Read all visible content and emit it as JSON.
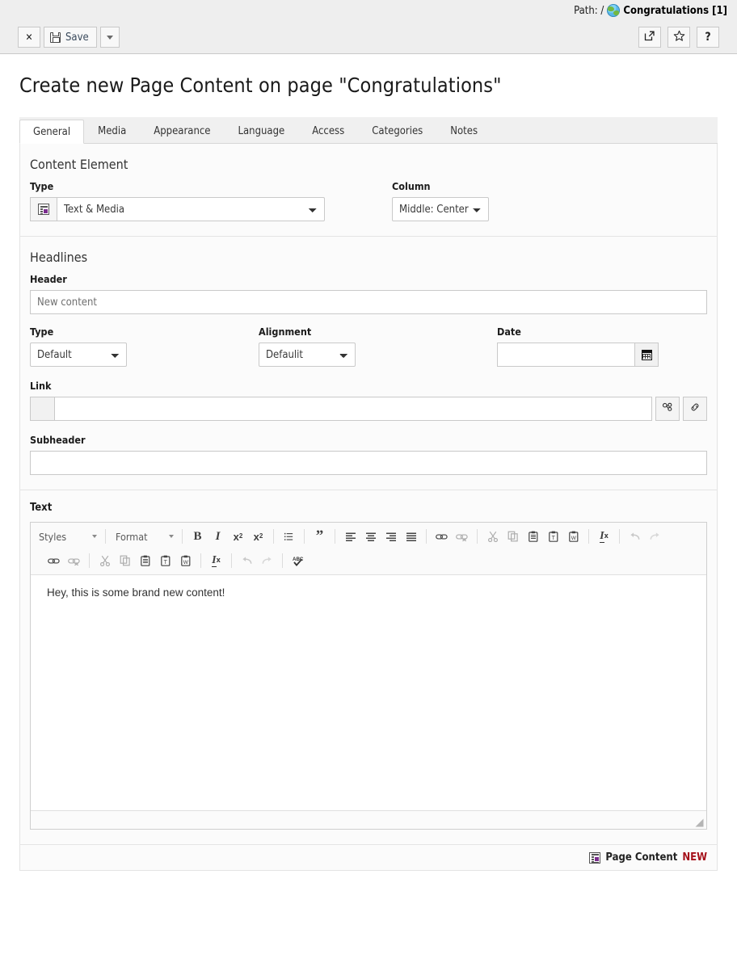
{
  "topbar": {
    "path_label": "Path: /",
    "globe_icon": "globe-icon",
    "page_name": "Congratulations [1]",
    "close_label": "✕",
    "save_label": "Save",
    "save_icon": "floppy-disk-icon",
    "save_caret": "caret-down-icon",
    "open_in_new_label": "open-in-new-icon",
    "bookmark_label": "star-icon",
    "help_label": "?"
  },
  "page_title": "Create new Page Content on page \"Congratulations\"",
  "tabs": [
    {
      "label": "General",
      "active": true
    },
    {
      "label": "Media",
      "active": false
    },
    {
      "label": "Appearance",
      "active": false
    },
    {
      "label": "Language",
      "active": false
    },
    {
      "label": "Access",
      "active": false
    },
    {
      "label": "Categories",
      "active": false
    },
    {
      "label": "Notes",
      "active": false
    }
  ],
  "content_element": {
    "section_title": "Content Element",
    "type_label": "Type",
    "type_value": "Text & Media",
    "type_icon": "text-media-icon",
    "column_label": "Column",
    "column_value": "Middle: Center"
  },
  "headlines": {
    "section_title": "Headlines",
    "header_label": "Header",
    "header_value": "New content",
    "header_placeholder": "New content",
    "type_label": "Type",
    "type_value": "Default",
    "alignment_label": "Alignment",
    "alignment_value": "Defaulit",
    "date_label": "Date",
    "date_value": "",
    "date_icon": "calendar-icon",
    "link_label": "Link",
    "link_value": "",
    "link_browse_icon": "link-browse-icon",
    "link_wizard_icon": "link-chain-icon",
    "subheader_label": "Subheader",
    "subheader_value": ""
  },
  "rte": {
    "label": "Text",
    "styles_label": "Styles",
    "format_label": "Format",
    "row1": [
      {
        "name": "bold-icon",
        "glyph": "B",
        "dim": false
      },
      {
        "name": "italic-icon",
        "glyph": "I",
        "dim": false
      },
      {
        "name": "subscript-icon",
        "glyph": "x₂",
        "dim": false
      },
      {
        "name": "superscript-icon",
        "glyph": "x²",
        "dim": false
      },
      {
        "name": "bulleted-list-icon",
        "glyph": "≡",
        "dim": false
      },
      {
        "name": "blockquote-icon",
        "glyph": "”",
        "dim": false
      },
      {
        "name": "align-left-icon",
        "glyph": "",
        "dim": false
      },
      {
        "name": "align-center-icon",
        "glyph": "",
        "dim": false
      },
      {
        "name": "align-right-icon",
        "glyph": "",
        "dim": false
      },
      {
        "name": "align-justify-icon",
        "glyph": "",
        "dim": false
      },
      {
        "name": "link-icon",
        "glyph": "",
        "dim": false
      },
      {
        "name": "unlink-icon",
        "glyph": "",
        "dim": true
      },
      {
        "name": "cut-icon",
        "glyph": "",
        "dim": true
      },
      {
        "name": "copy-icon",
        "glyph": "",
        "dim": true
      },
      {
        "name": "paste-icon",
        "glyph": "",
        "dim": false
      },
      {
        "name": "paste-as-text-icon",
        "glyph": "",
        "dim": false
      },
      {
        "name": "paste-from-word-icon",
        "glyph": "",
        "dim": false
      },
      {
        "name": "remove-format-icon",
        "glyph": "",
        "dim": false
      },
      {
        "name": "undo-icon",
        "glyph": "",
        "dim": true
      },
      {
        "name": "redo-icon",
        "glyph": "",
        "dim": true
      }
    ],
    "row2": [
      {
        "name": "link-icon",
        "glyph": "",
        "dim": false
      },
      {
        "name": "unlink-icon",
        "glyph": "",
        "dim": true
      },
      {
        "name": "cut-icon",
        "glyph": "",
        "dim": true
      },
      {
        "name": "copy-icon",
        "glyph": "",
        "dim": true
      },
      {
        "name": "paste-icon",
        "glyph": "",
        "dim": false
      },
      {
        "name": "paste-as-text-icon",
        "glyph": "",
        "dim": false
      },
      {
        "name": "paste-from-word-icon",
        "glyph": "",
        "dim": false
      },
      {
        "name": "remove-format-icon",
        "glyph": "",
        "dim": false
      },
      {
        "name": "undo-icon",
        "glyph": "",
        "dim": true
      },
      {
        "name": "redo-icon",
        "glyph": "",
        "dim": true
      },
      {
        "name": "spellcheck-icon",
        "glyph": "",
        "dim": false
      }
    ],
    "body_text": "Hey, this is some brand new content!",
    "resize_handle": "resize-grip-icon"
  },
  "bottom": {
    "icon": "page-content-icon",
    "label": "Page Content",
    "status": "NEW"
  },
  "colors": {
    "accent_purple": "#7b2d8e",
    "status_new_red": "#a5101a",
    "topbar_bg": "#eeeeee",
    "section_bg": "#fbfbfb"
  }
}
